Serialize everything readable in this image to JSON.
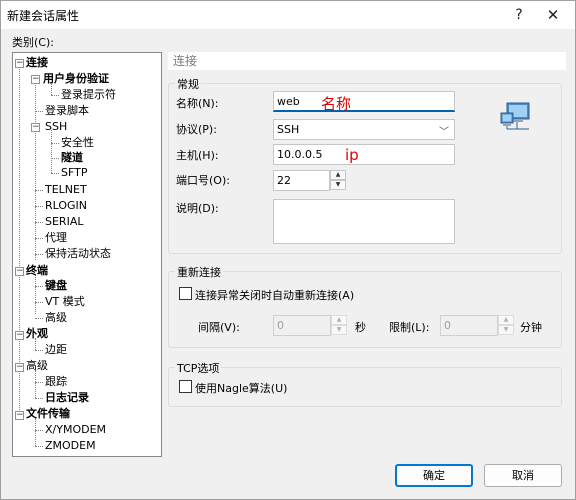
{
  "window": {
    "title": "新建会话属性",
    "help_glyph": "?",
    "close_glyph": "✕"
  },
  "category_label": "类别(C):",
  "tree": {
    "connection": "连接",
    "user_auth": "用户身份验证",
    "login_prompt": "登录提示符",
    "login_script": "登录脚本",
    "ssh": "SSH",
    "security": "安全性",
    "tunnel": "隧道",
    "sftp": "SFTP",
    "telnet": "TELNET",
    "rlogin": "RLOGIN",
    "serial": "SERIAL",
    "proxy": "代理",
    "keepalive": "保持活动状态",
    "terminal": "终端",
    "keyboard": "键盘",
    "vt_mode": "VT 模式",
    "advanced_term": "高级",
    "appearance": "外观",
    "margin": "边距",
    "advanced": "高级",
    "trace": "跟踪",
    "log": "日志记录",
    "file_transfer": "文件传输",
    "xymodem": "X/YMODEM",
    "zmodem": "ZMODEM"
  },
  "panel": {
    "header": "连接",
    "general": {
      "title": "常规",
      "name_label": "名称(N):",
      "name_value": "web",
      "protocol_label": "协议(P):",
      "protocol_value": "SSH",
      "host_label": "主机(H):",
      "host_value": "10.0.0.5",
      "port_label": "端口号(O):",
      "port_value": "22",
      "desc_label": "说明(D):",
      "desc_value": ""
    },
    "reconnect": {
      "title": "重新连接",
      "auto_label": "连接异常关闭时自动重新连接(A)",
      "interval_label": "间隔(V):",
      "interval_value": "0",
      "seconds": "秒",
      "limit_label": "限制(L):",
      "limit_value": "0",
      "minutes": "分钟"
    },
    "tcp": {
      "title": "TCP选项",
      "nagle_label": "使用Nagle算法(U)"
    }
  },
  "annotations": {
    "name": "名称",
    "ip": "ip"
  },
  "buttons": {
    "ok": "确定",
    "cancel": "取消"
  },
  "icons": {
    "session_icon": "network-computer-icon"
  }
}
